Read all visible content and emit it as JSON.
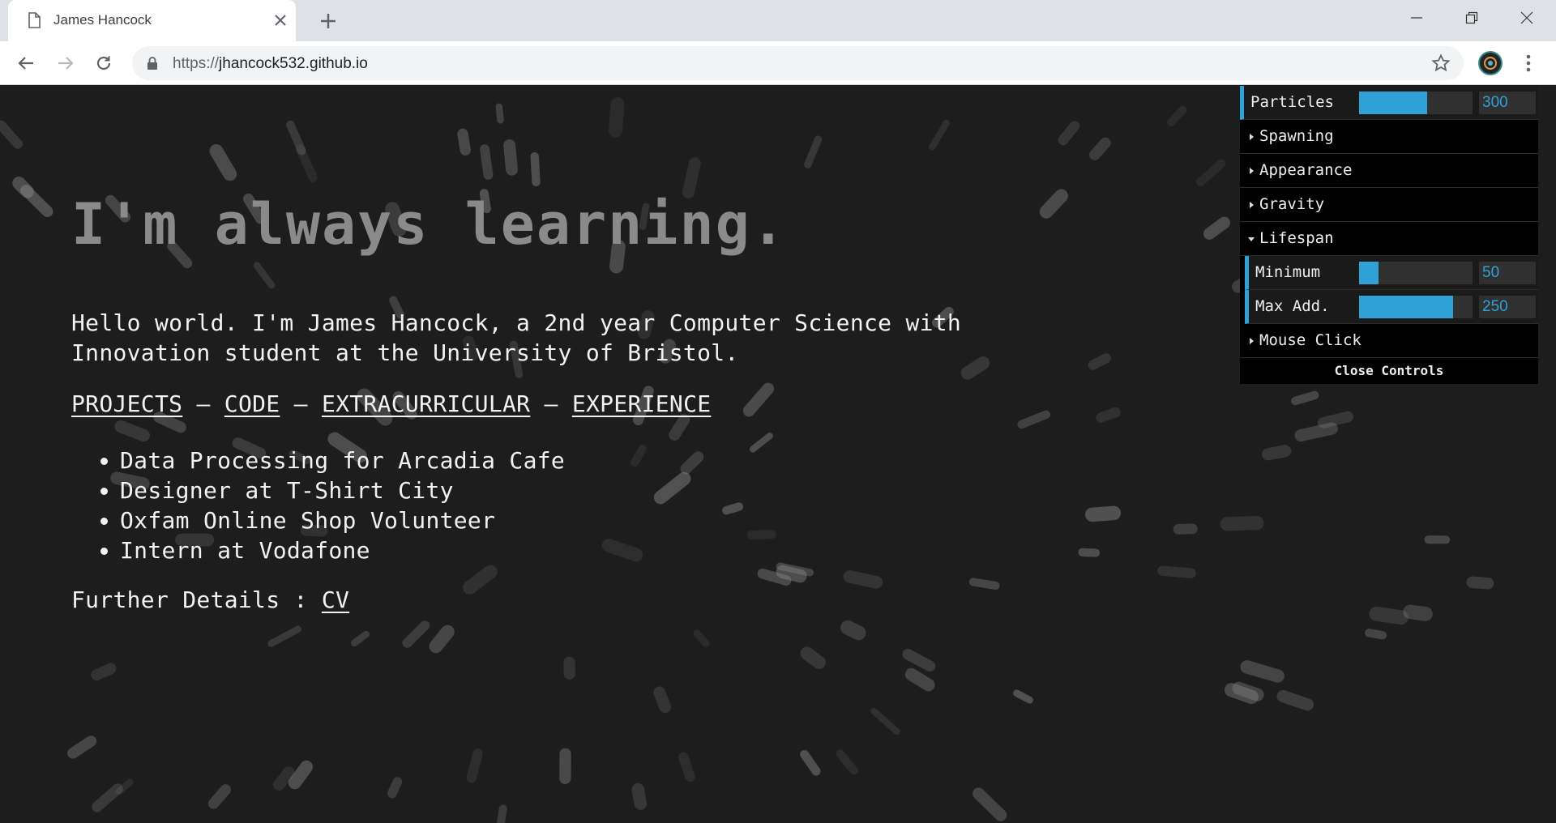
{
  "browser": {
    "tab_title": "James Hancock",
    "url_scheme": "https://",
    "url_host": "jhancock532.github.io",
    "icons": [
      "document-icon",
      "close-icon",
      "plus-icon",
      "minimize-icon",
      "maximize-icon",
      "window-close-icon",
      "back-arrow-icon",
      "forward-arrow-icon",
      "reload-icon",
      "lock-icon",
      "star-icon",
      "profile-avatar",
      "menu-dots-icon"
    ]
  },
  "page": {
    "headline": "I'm always learning.",
    "intro": "Hello world. I'm James Hancock, a 2nd year Computer Science with Innovation student at the University of Bristol.",
    "nav": {
      "projects": "PROJECTS",
      "code": "CODE",
      "extracurricular": "EXTRACURRICULAR",
      "experience": "EXPERIENCE",
      "separator": "—"
    },
    "experience_items": [
      "Data Processing for Arcadia Cafe",
      "Designer at T-Shirt City",
      "Oxfam Online Shop Volunteer",
      "Intern at Vodafone"
    ],
    "further_label": "Further Details : ",
    "cv_link": "CV"
  },
  "controls": {
    "particles": {
      "label": "Particles",
      "value": "300",
      "fraction": 0.6
    },
    "folders": {
      "spawning": "Spawning",
      "appearance": "Appearance",
      "gravity": "Gravity",
      "lifespan": "Lifespan",
      "mouse_click": "Mouse Click"
    },
    "lifespan": {
      "minimum": {
        "label": "Minimum",
        "value": "50",
        "fraction": 0.17
      },
      "max_add": {
        "label": "Max Add.",
        "value": "250",
        "fraction": 0.83
      }
    },
    "close_label": "Close Controls",
    "accent_color": "#2fa1d6"
  }
}
